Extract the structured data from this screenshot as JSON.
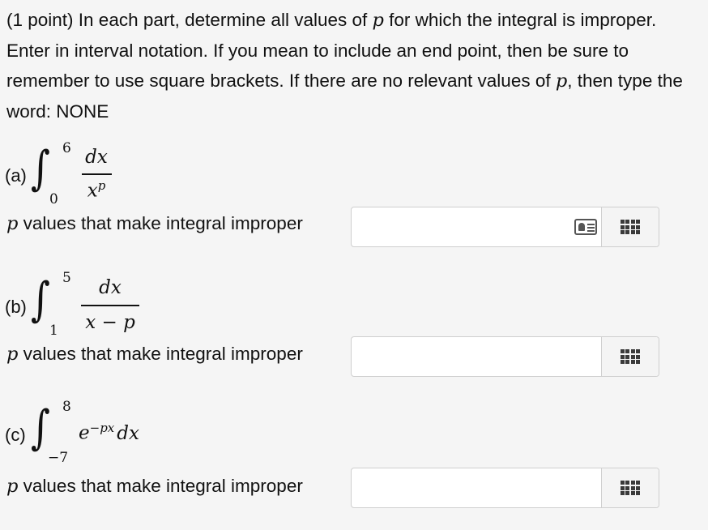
{
  "intro": {
    "t1": "(1 point) In each part, determine all values of ",
    "p1": "p",
    "t2": " for which the integral is improper. Enter in interval notation. If you mean to include an end point, then be sure to remember to use square brackets. If there are no relevant values of ",
    "p2": "p",
    "t3": ", then type the word: NONE"
  },
  "parts": [
    {
      "label": "(a)",
      "upper": "6",
      "lower": "0",
      "numerator": "dx",
      "denominator_base": "x",
      "denominator_exp": "p",
      "row_var": "p",
      "row_text": " values that make integral improper",
      "input_value": "",
      "has_card_icon": true
    },
    {
      "label": "(b)",
      "upper": "5",
      "lower": "1",
      "numerator": "dx",
      "denominator": "x − p",
      "row_var": "p",
      "row_text": " values that make integral improper",
      "input_value": ""
    },
    {
      "label": "(c)",
      "upper": "8",
      "lower": "−7",
      "integrand_base": "e",
      "integrand_exp": "−px",
      "integrand_tail": "dx",
      "row_var": "p",
      "row_text": " values that make integral improper",
      "input_value": ""
    }
  ],
  "icons": {
    "grid": "grid-menu-icon",
    "card": "contact-card-icon"
  }
}
